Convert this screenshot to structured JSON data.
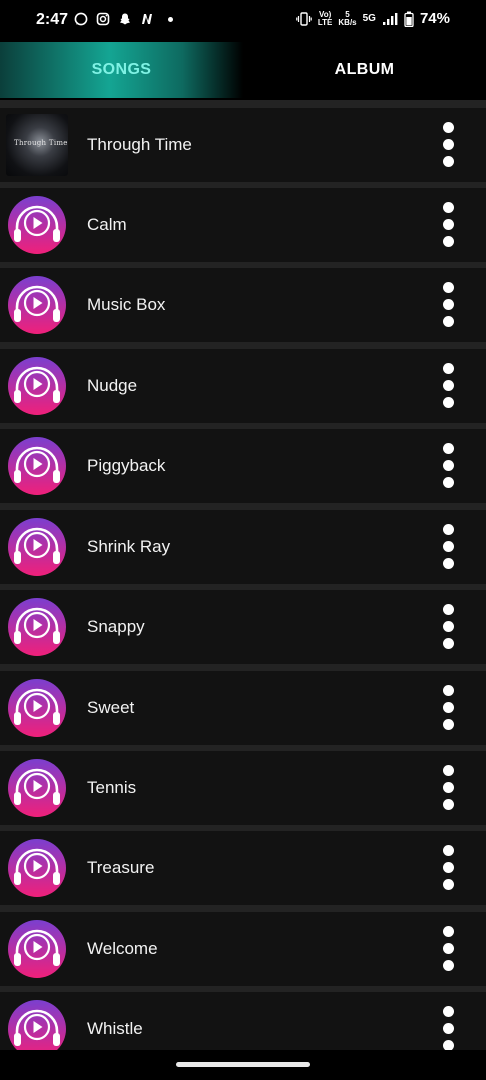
{
  "status_bar": {
    "time": "2:47",
    "volte_top": "Vo)",
    "volte_bottom": "LTE",
    "speed_value": "5",
    "speed_unit": "KB/s",
    "network": "5G",
    "battery": "74%"
  },
  "tabs": [
    {
      "label": "SONGS",
      "active": true
    },
    {
      "label": "ALBUM",
      "active": false
    }
  ],
  "songs": [
    {
      "title": "Through Time",
      "art": "album-photo",
      "art_text": "Through Time"
    },
    {
      "title": "Calm",
      "art": "headphones-icon"
    },
    {
      "title": "Music Box",
      "art": "headphones-icon"
    },
    {
      "title": "Nudge",
      "art": "headphones-icon"
    },
    {
      "title": "Piggyback",
      "art": "headphones-icon"
    },
    {
      "title": "Shrink Ray",
      "art": "headphones-icon"
    },
    {
      "title": "Snappy",
      "art": "headphones-icon"
    },
    {
      "title": "Sweet",
      "art": "headphones-icon"
    },
    {
      "title": "Tennis",
      "art": "headphones-icon"
    },
    {
      "title": "Treasure",
      "art": "headphones-icon"
    },
    {
      "title": "Welcome",
      "art": "headphones-icon"
    },
    {
      "title": "Whistle",
      "art": "headphones-icon"
    }
  ],
  "colors": {
    "background": "#000000",
    "row": "#121212",
    "row_gap": "#232323",
    "tab_active": "#14a593",
    "art_top": "#7b3fcf",
    "art_bottom": "#f0207a"
  }
}
